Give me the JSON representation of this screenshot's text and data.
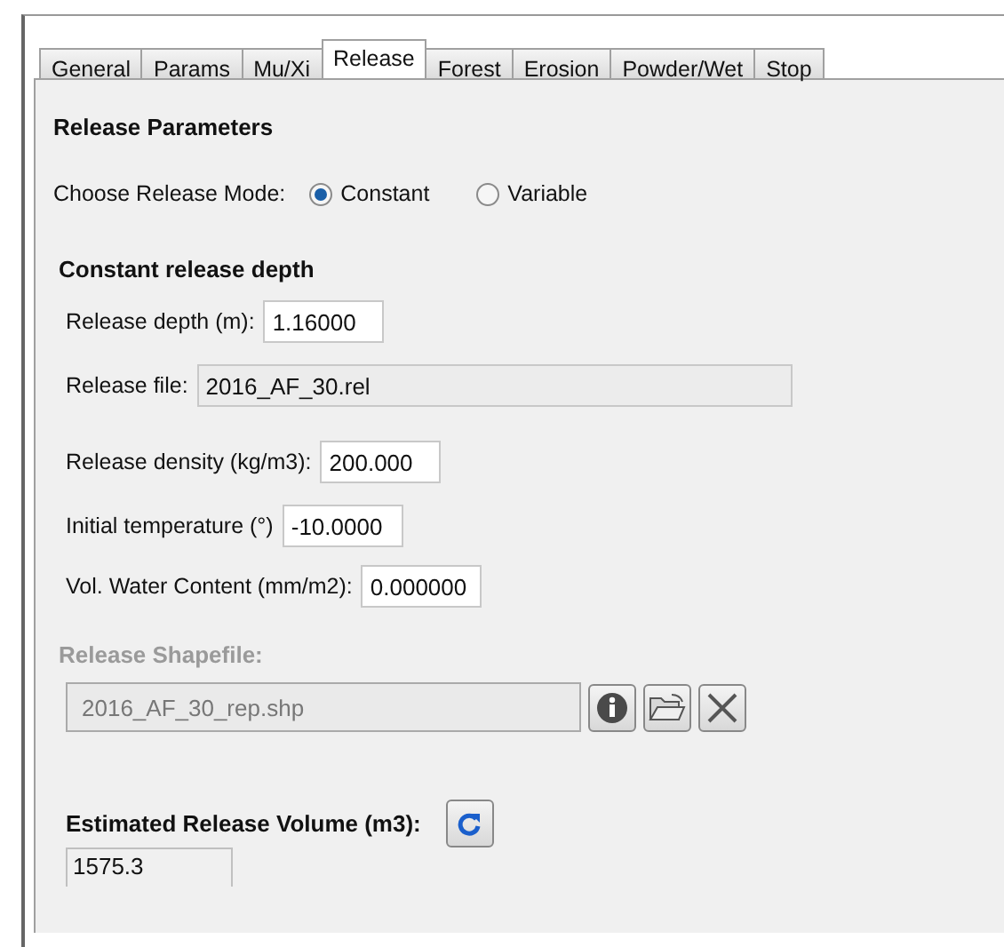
{
  "tabs": [
    {
      "label": "General",
      "selected": false
    },
    {
      "label": "Params",
      "selected": false
    },
    {
      "label": "Mu/Xi",
      "selected": false
    },
    {
      "label": "Release",
      "selected": true
    },
    {
      "label": "Forest",
      "selected": false
    },
    {
      "label": "Erosion",
      "selected": false
    },
    {
      "label": "Powder/Wet",
      "selected": false
    },
    {
      "label": "Stop",
      "selected": false
    }
  ],
  "section_title": "Release Parameters",
  "release_mode": {
    "label": "Choose Release Mode:",
    "options": [
      {
        "label": "Constant",
        "selected": true
      },
      {
        "label": "Variable",
        "selected": false
      }
    ]
  },
  "constant_group": {
    "title": "Constant release depth",
    "fields": [
      {
        "label": "Release depth (m):",
        "value": "1.16000",
        "disabled": false
      },
      {
        "label": "Release file:",
        "value": "2016_AF_30.rel",
        "disabled": true
      },
      {
        "label": "Release density (kg/m3):",
        "value": "200.000",
        "disabled": false
      },
      {
        "label": "Initial temperature (°)",
        "value": "-10.0000",
        "disabled": false
      },
      {
        "label": "Vol. Water Content (mm/m2):",
        "value": "0.000000",
        "disabled": false
      }
    ]
  },
  "shapefile": {
    "label": "Release Shapefile:",
    "value": "2016_AF_30_rep.shp",
    "disabled": true
  },
  "volume": {
    "label": "Estimated Release Volume (m3):",
    "value": "1575.3"
  }
}
